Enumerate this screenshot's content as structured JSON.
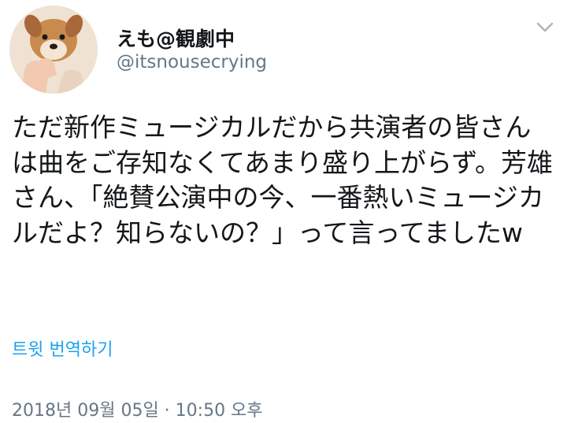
{
  "user": {
    "display_name": "えも@観劇中",
    "handle": "@itsnousecrying",
    "avatar_icon": "puppy-avatar-icon"
  },
  "menu": {
    "icon": "chevron-down-icon"
  },
  "tweet": {
    "text": "ただ新作ミュージカルだから共演者の皆さんは曲をご存知なくてあまり盛り上がらず。芳雄さん、「絶賛公演中の今、一番熱いミュージカルだよ？知らないの？」って言ってましたw",
    "translate_label": "트윗 번역하기",
    "timestamp": "2018년 09월 05일 · 10:50 오후"
  },
  "colors": {
    "text": "#14171a",
    "secondary": "#657786",
    "link": "#1da1f2"
  }
}
